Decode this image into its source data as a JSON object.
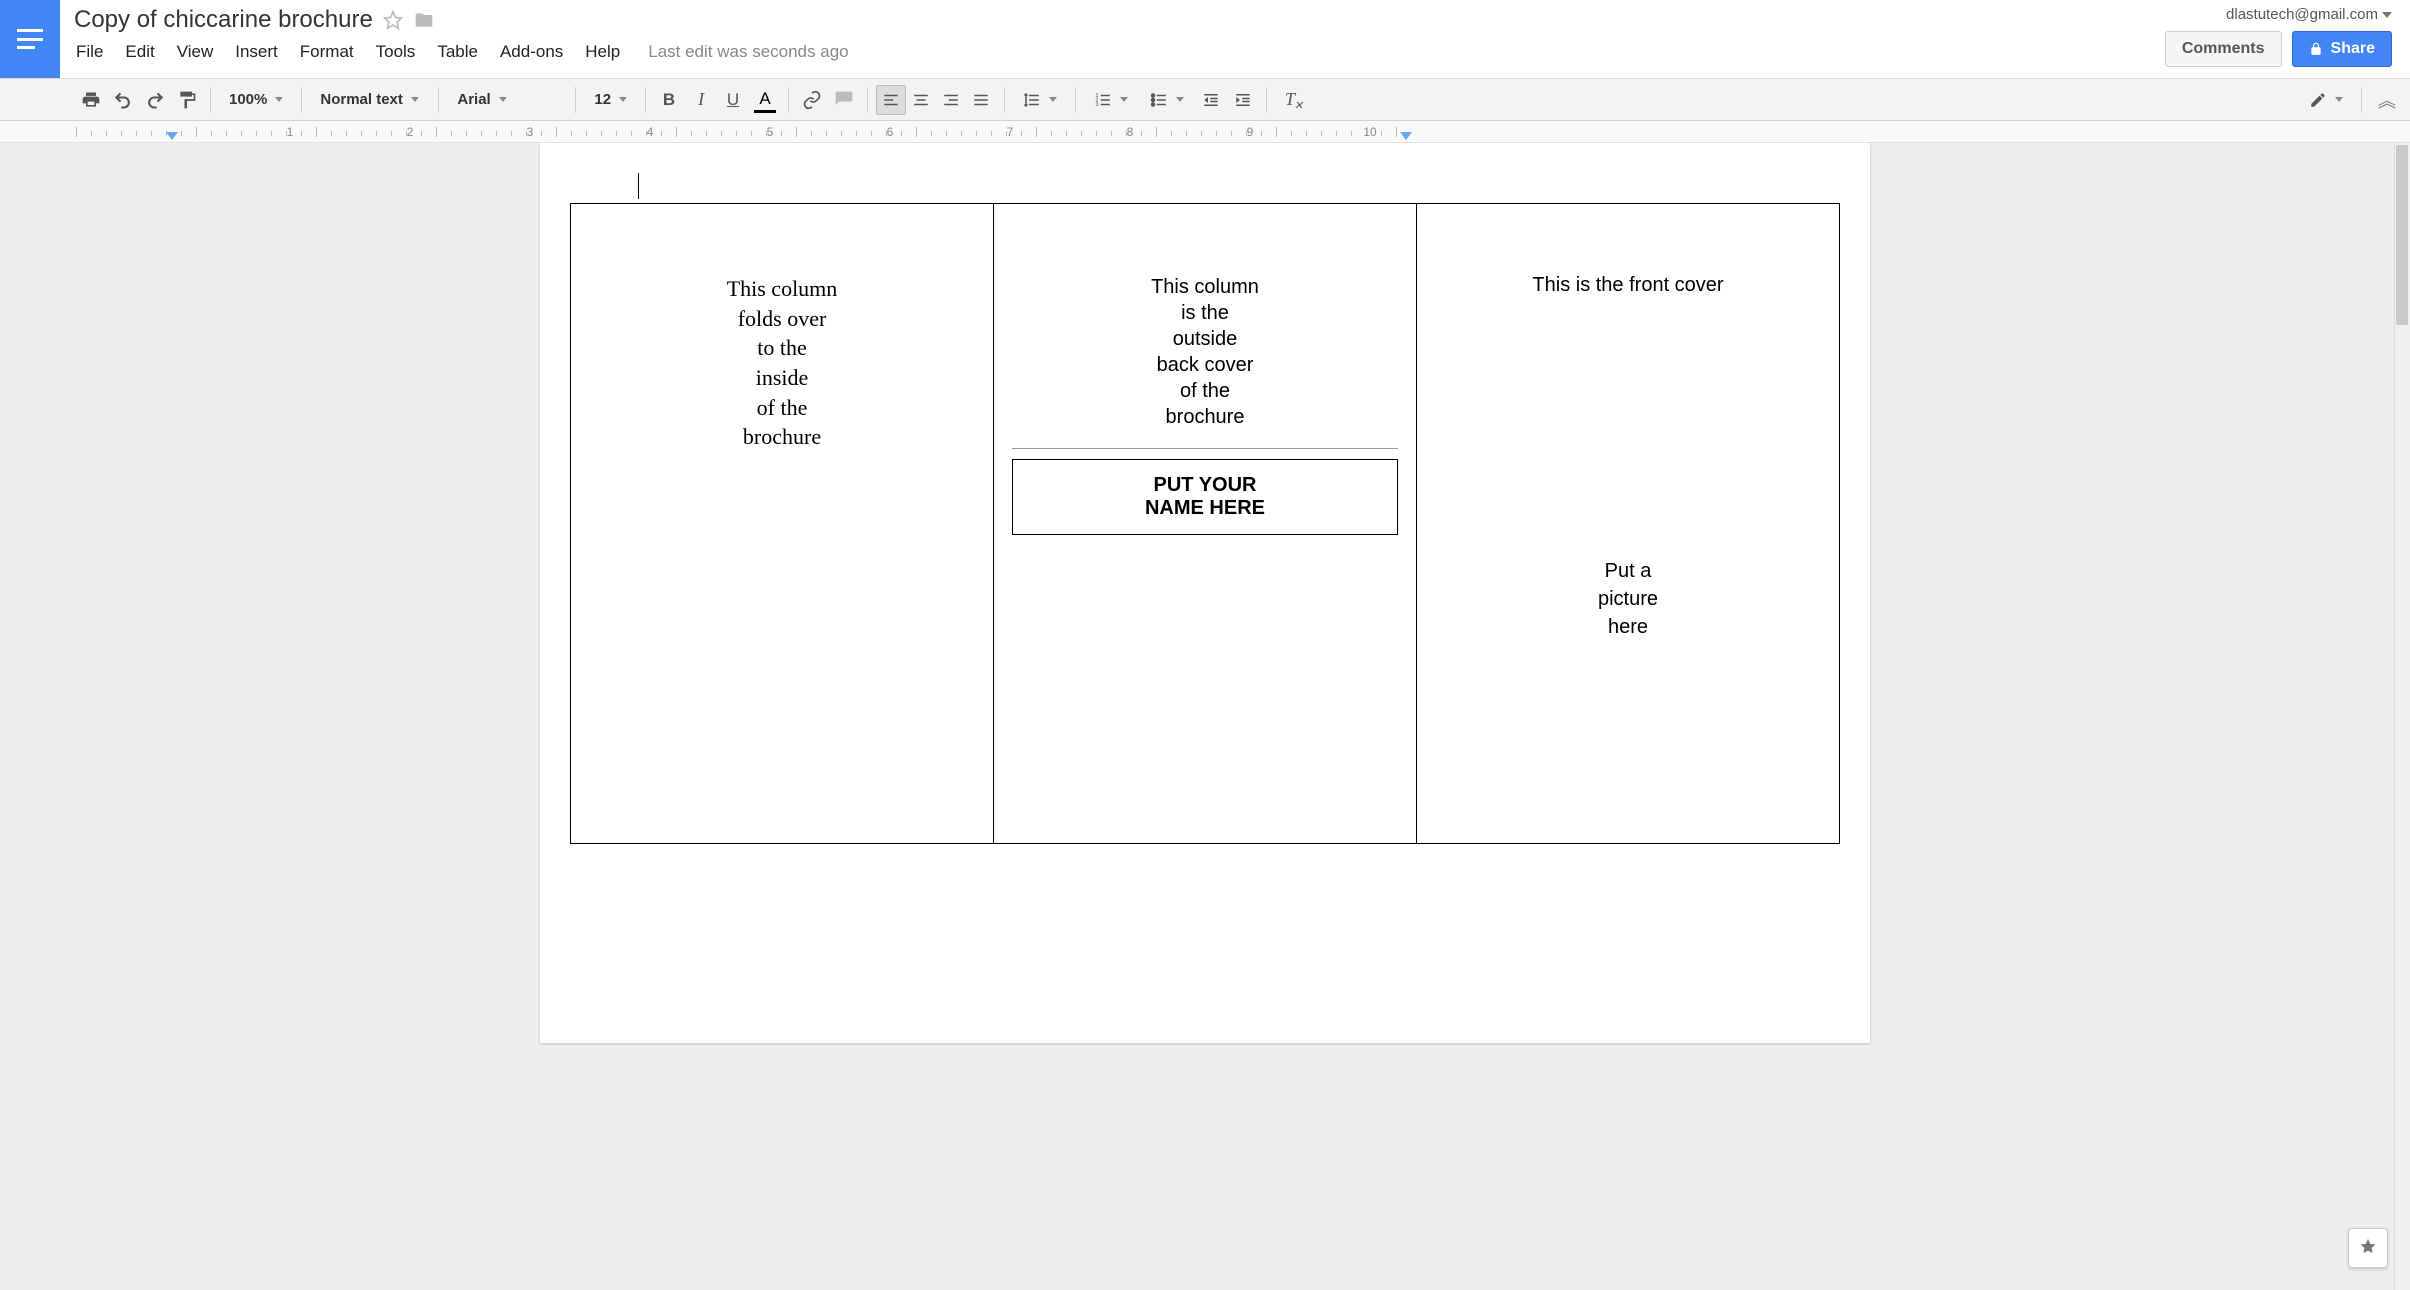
{
  "account": {
    "email": "dlastutech@gmail.com"
  },
  "doc": {
    "title": "Copy of chiccarine brochure",
    "last_edit": "Last edit was seconds ago"
  },
  "menus": {
    "file": "File",
    "edit": "Edit",
    "view": "View",
    "insert": "Insert",
    "format": "Format",
    "tools": "Tools",
    "table": "Table",
    "addons": "Add-ons",
    "help": "Help"
  },
  "buttons": {
    "comments": "Comments",
    "share": "Share"
  },
  "toolbar": {
    "zoom": "100%",
    "style": "Normal text",
    "font": "Arial",
    "size": "12"
  },
  "ruler": {
    "numbers": [
      "1",
      "2",
      "3",
      "4",
      "5",
      "6",
      "7",
      "8",
      "9",
      "10"
    ]
  },
  "content": {
    "col1": "This column\nfolds over\nto the\ninside\nof the\nbrochure",
    "col2_top": "This column\nis the\noutside\nback cover\nof the\nbrochure",
    "col2_box": "PUT YOUR\nNAME HERE",
    "col3_top": "This is the front cover",
    "col3_pic": "Put a\npicture\nhere"
  }
}
